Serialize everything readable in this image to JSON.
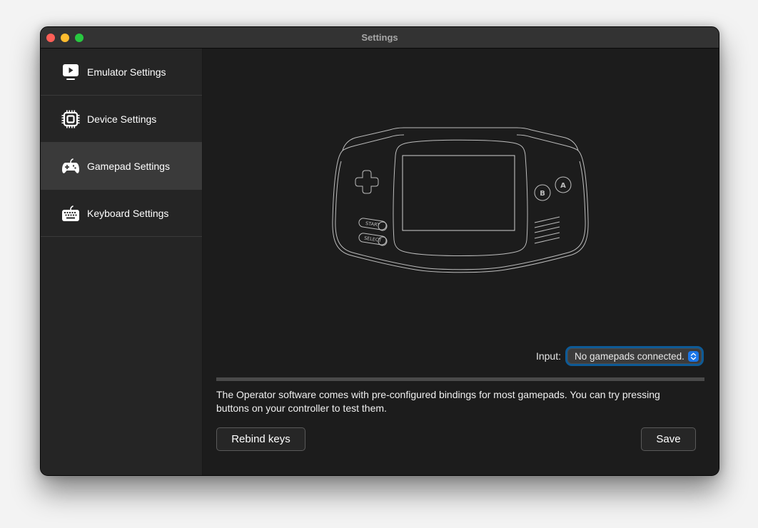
{
  "window": {
    "title": "Settings"
  },
  "sidebar": {
    "items": [
      {
        "label": "Emulator Settings",
        "icon": "tv-play-icon",
        "active": false
      },
      {
        "label": "Device Settings",
        "icon": "cpu-chip-icon",
        "active": false
      },
      {
        "label": "Gamepad Settings",
        "icon": "gamepad-icon",
        "active": true
      },
      {
        "label": "Keyboard Settings",
        "icon": "keyboard-icon",
        "active": false
      }
    ]
  },
  "main": {
    "illustration": {
      "start_label": "START",
      "select_label": "SELECT",
      "button_a": "A",
      "button_b": "B"
    },
    "input": {
      "label": "Input:",
      "selected": "No gamepads connected."
    },
    "description": "The Operator software comes with pre-configured bindings for most gamepads. You can try pressing buttons on your controller to test them.",
    "buttons": {
      "rebind": "Rebind keys",
      "save": "Save"
    }
  },
  "colors": {
    "accent": "#1a76e8",
    "focus_ring": "#0d5a96",
    "active_item": "#3a3a3a"
  }
}
